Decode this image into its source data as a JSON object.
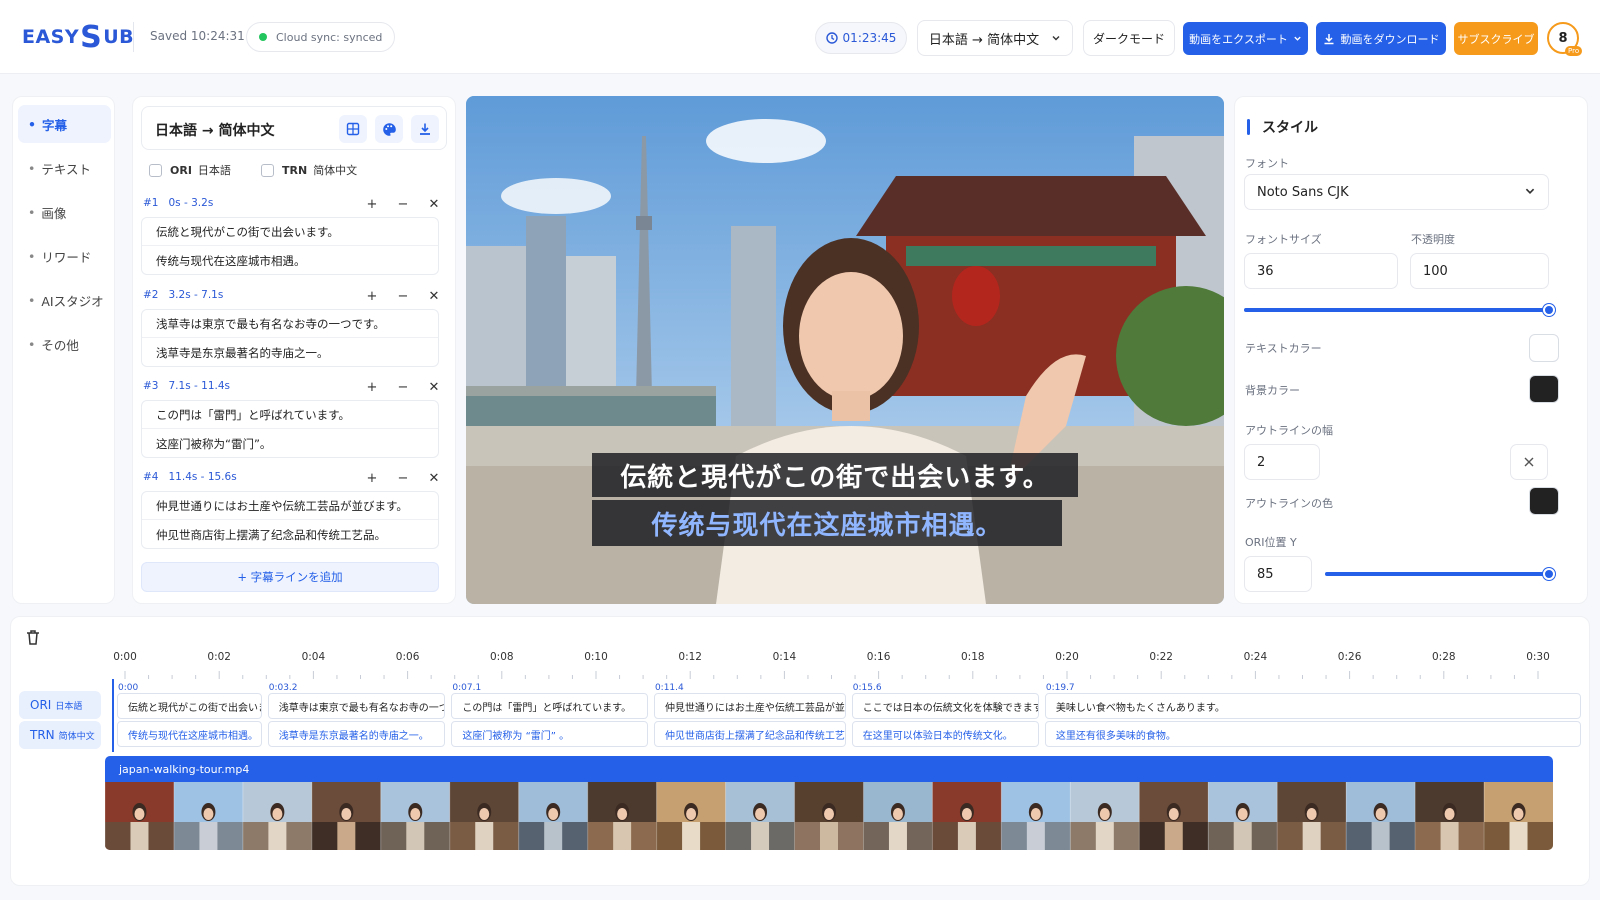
{
  "app": {
    "logo_left": "EASY",
    "logo_s": "S",
    "logo_right": "UB",
    "saved": "Saved 10:24:31",
    "sync": "Cloud sync: synced",
    "timer": "01:23:45",
    "lang_pair": "日本語 → 简体中文",
    "dark_mode": "ダークモード",
    "export": "動画をエクスポート",
    "download": "動画をダウンロード",
    "subscribe": "サブスクライブ",
    "avatar_num": "8",
    "avatar_badge": "Pro"
  },
  "nav": {
    "items": [
      {
        "label": "字幕",
        "active": true
      },
      {
        "label": "テキスト"
      },
      {
        "label": "画像"
      },
      {
        "label": "リワード"
      },
      {
        "label": "AIスタジオ"
      },
      {
        "label": "その他"
      }
    ]
  },
  "subtitles": {
    "title": "日本語 → 简体中文",
    "ori_tag": "ORI",
    "ori_lang": "日本語",
    "trn_tag": "TRN",
    "trn_lang": "简体中文",
    "add_line": "+ 字幕ラインを追加",
    "entries": [
      {
        "num": "#1",
        "range": "0s - 3.2s",
        "ori": "伝統と現代がこの街で出会います。",
        "trn": "传统与现代在这座城市相遇。"
      },
      {
        "num": "#2",
        "range": "3.2s - 7.1s",
        "ori": "浅草寺は東京で最も有名なお寺の一つです。",
        "trn": "浅草寺是东京最著名的寺庙之一。"
      },
      {
        "num": "#3",
        "range": "7.1s - 11.4s",
        "ori": "この門は「雷門」と呼ばれています。",
        "trn": "这座门被称为“雷门”。"
      },
      {
        "num": "#4",
        "range": "11.4s - 15.6s",
        "ori": "仲見世通りにはお土産や伝統工芸品が並びます。",
        "trn": "仲见世商店街上摆满了纪念品和传统工艺品。"
      }
    ]
  },
  "preview": {
    "caption_ori": "伝統と現代がこの街で出会います。",
    "caption_trn": "传统与现代在这座城市相遇。"
  },
  "style": {
    "heading": "スタイル",
    "font_label": "フォント",
    "font_value": "Noto Sans CJK",
    "size_label": "フォントサイズ",
    "size_value": "36",
    "opacity_label": "不透明度",
    "opacity_value": "100",
    "opacity_fraction": 1.0,
    "text_color_label": "テキストカラー",
    "text_color": "#ffffff",
    "bg_color_label": "背景カラー",
    "bg_color": "#222222",
    "outline_width_label": "アウトラインの幅",
    "outline_width_value": "2",
    "outline_color_label": "アウトラインの色",
    "outline_color": "#222222",
    "ori_pos_label": "ORI位置 Y",
    "ori_pos_value": "85",
    "ori_pos_fraction": 1.0
  },
  "timeline": {
    "ticks": [
      "0:00",
      "0:02",
      "0:04",
      "0:06",
      "0:08",
      "0:10",
      "0:12",
      "0:14",
      "0:16",
      "0:18",
      "0:20",
      "0:22",
      "0:24",
      "0:26",
      "0:28",
      "0:30"
    ],
    "ori_label": "ORI",
    "ori_lang": "日本語",
    "trn_label": "TRN",
    "trn_lang": "简体中文",
    "segments": [
      {
        "start": "0:00",
        "ori": "伝統と現代がこの街で出会います。",
        "trn": "传统与现代在这座城市相遇。"
      },
      {
        "start": "0:03.2",
        "ori": "浅草寺は東京で最も有名なお寺の一つです。",
        "trn": "浅草寺是东京最著名的寺庙之一。"
      },
      {
        "start": "0:07.1",
        "ori": "この門は「雷門」と呼ばれています。",
        "trn": "这座门被称为 “雷门” 。"
      },
      {
        "start": "0:11.4",
        "ori": "仲見世通りにはお土産や伝統工芸品が並びます。",
        "trn": "仲见世商店街上摆满了纪念品和传统工艺品。"
      },
      {
        "start": "0:15.6",
        "ori": "ここでは日本の伝統文化を体験できます。",
        "trn": "在这里可以体验日本的传统文化。"
      },
      {
        "start": "0:19.7",
        "ori": "美味しい食べ物もたくさんあります。",
        "trn": "这里还有很多美味的食物。"
      }
    ],
    "clip_name": "japan-walking-tour.mp4"
  }
}
